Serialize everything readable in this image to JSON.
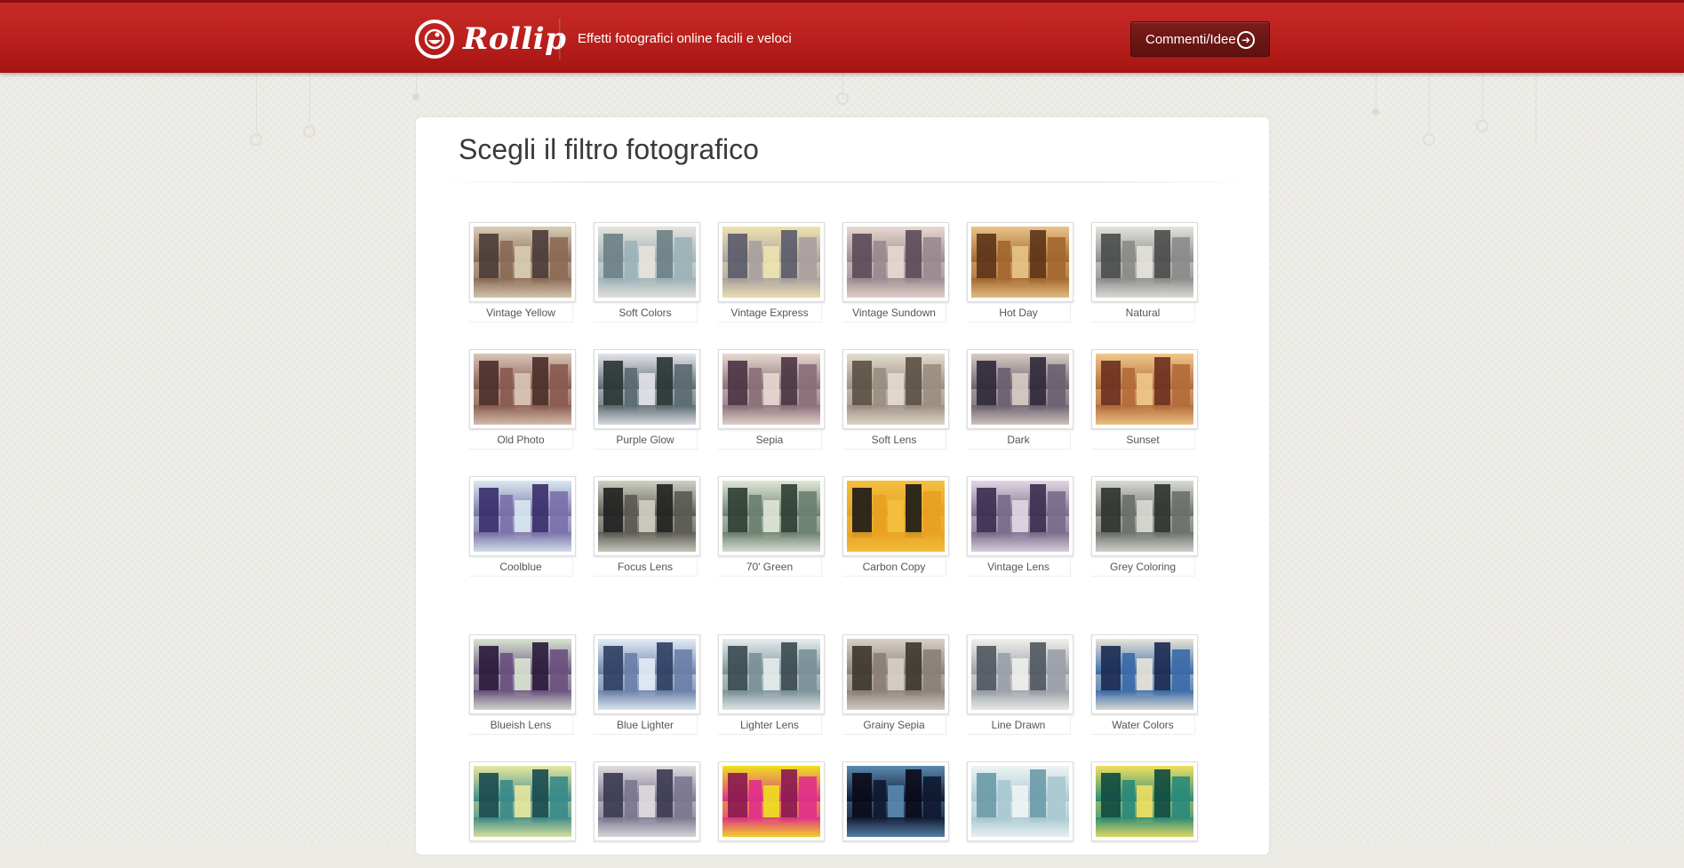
{
  "header": {
    "logo_text": "Rollip",
    "tagline": "Effetti fotografici online facili e veloci",
    "feedback_button": "Commenti/Idee"
  },
  "main": {
    "title": "Scegli il filtro fotografico",
    "filters": [
      {
        "label": "Vintage Yellow",
        "c": [
          "#8b6a55",
          "#d9cdb6",
          "#4a3c3a"
        ]
      },
      {
        "label": "Soft Colors",
        "c": [
          "#9bb2b8",
          "#e7e4dc",
          "#6b7f86"
        ]
      },
      {
        "label": "Vintage Express",
        "c": [
          "#a8a0a0",
          "#efe3b0",
          "#5a5a6a"
        ]
      },
      {
        "label": "Vintage Sundown",
        "c": [
          "#9a8a90",
          "#e8d8d0",
          "#5b4a58"
        ]
      },
      {
        "label": "Hot Day",
        "c": [
          "#a3672f",
          "#e8c48a",
          "#5b3318"
        ]
      },
      {
        "label": "Natural",
        "c": [
          "#8a8c8a",
          "#e4e2dc",
          "#4a4d4c"
        ]
      },
      {
        "label": "Old Photo",
        "c": [
          "#8a5a50",
          "#d9c6b6",
          "#4a2e2a"
        ]
      },
      {
        "label": "Purple Glow",
        "c": [
          "#5a6a70",
          "#e4e4ea",
          "#2a3434"
        ]
      },
      {
        "label": "Sepia",
        "c": [
          "#8a6e78",
          "#e8d8d0",
          "#4a3444"
        ]
      },
      {
        "label": "Soft Lens",
        "c": [
          "#9a8e80",
          "#e4dcd0",
          "#5a5044"
        ]
      },
      {
        "label": "Dark",
        "c": [
          "#6a6070",
          "#d8ccc4",
          "#2e2838"
        ]
      },
      {
        "label": "Sunset",
        "c": [
          "#b36a3a",
          "#f0c88a",
          "#6a3020"
        ]
      },
      {
        "label": "Coolblue",
        "c": [
          "#7a70a8",
          "#d8e8f0",
          "#3a2e6a"
        ]
      },
      {
        "label": "Focus Lens",
        "c": [
          "#5a5a52",
          "#cfcfc4",
          "#202020"
        ]
      },
      {
        "label": "70' Green",
        "c": [
          "#6a8070",
          "#dfe6d8",
          "#2f3e34"
        ]
      },
      {
        "label": "Carbon Copy",
        "c": [
          "#e8a020",
          "#f4c040",
          "#1a1a1a"
        ]
      },
      {
        "label": "Vintage Lens",
        "c": [
          "#7a6a8a",
          "#e0d8e4",
          "#3a2e50"
        ]
      },
      {
        "label": "Grey Coloring",
        "c": [
          "#6c706a",
          "#d8dad4",
          "#2f322e"
        ]
      },
      {
        "label": "Blueish Lens",
        "c": [
          "#6a5080",
          "#d8e4d0",
          "#2a1a3a"
        ]
      },
      {
        "label": "Blue Lighter",
        "c": [
          "#6a80a8",
          "#e4ecf6",
          "#2e3e60"
        ]
      },
      {
        "label": "Lighter Lens",
        "c": [
          "#7a9098",
          "#e6ecec",
          "#3a4a50"
        ]
      },
      {
        "label": "Grainy Sepia",
        "c": [
          "#8a8078",
          "#d8d0c6",
          "#3c3630"
        ]
      },
      {
        "label": "Line Drawn",
        "c": [
          "#9aa0a8",
          "#f0f0ec",
          "#50565e"
        ]
      },
      {
        "label": "Water Colors",
        "c": [
          "#3a6aa8",
          "#e8e4d8",
          "#1a2a50"
        ]
      },
      {
        "label": "",
        "c": [
          "#3a8a8a",
          "#e8e8a0",
          "#1a4a50"
        ]
      },
      {
        "label": "",
        "c": [
          "#7a7890",
          "#e0dce0",
          "#3a3850"
        ]
      },
      {
        "label": "",
        "c": [
          "#e0308a",
          "#f0e020",
          "#8a1850"
        ]
      },
      {
        "label": "",
        "c": [
          "#101830",
          "#5a8ab0",
          "#0a0a18"
        ]
      },
      {
        "label": "",
        "c": [
          "#a8c8d0",
          "#eef4f4",
          "#6a9aa8"
        ]
      },
      {
        "label": "",
        "c": [
          "#2a8a7a",
          "#f0e060",
          "#104a40"
        ]
      }
    ]
  }
}
